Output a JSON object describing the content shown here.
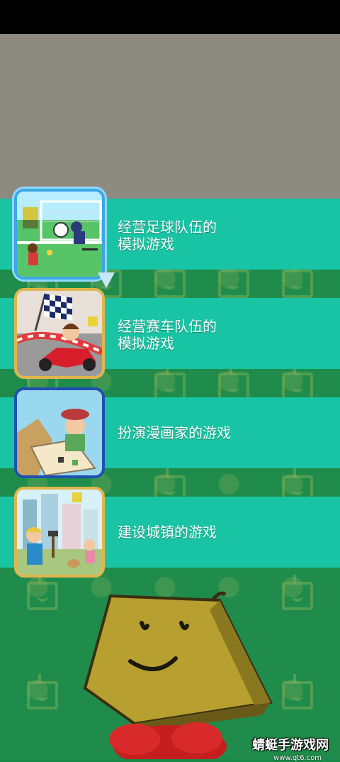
{
  "games": [
    {
      "label_line1": "经营足球队伍的",
      "label_line2": "模拟游戏"
    },
    {
      "label_line1": "经营赛车队伍的",
      "label_line2": "模拟游戏"
    },
    {
      "label_line1": "扮演漫画家的游戏",
      "label_line2": ""
    },
    {
      "label_line1": "建设城镇的游戏",
      "label_line2": ""
    }
  ],
  "watermark": {
    "text": "蜻蜓手游戏网",
    "url": "www.qt6.com"
  },
  "colors": {
    "band": "#18c4a4",
    "background": "#1f8c4b",
    "top_panel": "#8d8b80"
  }
}
